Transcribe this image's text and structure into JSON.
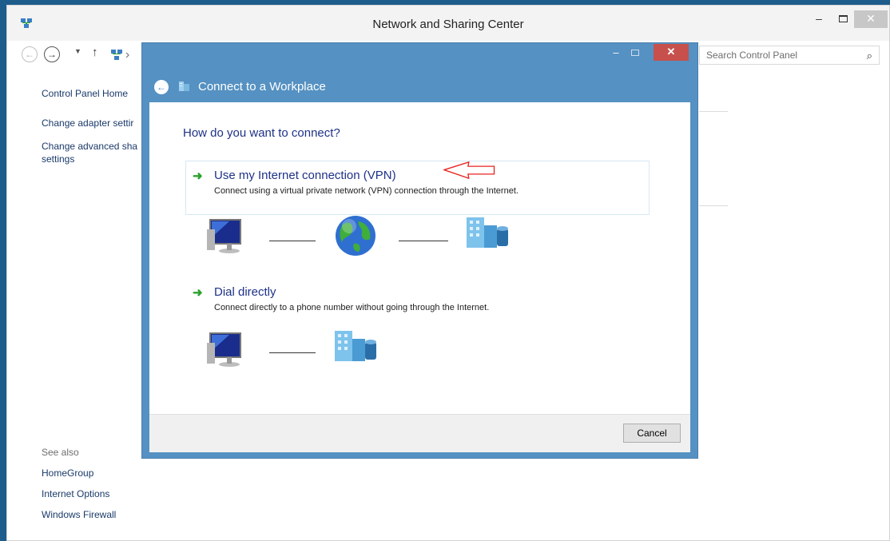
{
  "parent_window": {
    "title": "Network and Sharing Center",
    "controls": {
      "minimize": "–",
      "close": "✕"
    },
    "search": {
      "placeholder": "Search Control Panel"
    },
    "left_nav": {
      "home": "Control Panel Home",
      "change_adapter": "Change adapter settir",
      "change_advanced_line1": "Change advanced sha",
      "change_advanced_line2": "settings",
      "see_also": "See also",
      "see_also_links": [
        "HomeGroup",
        "Internet Options",
        "Windows Firewall"
      ]
    }
  },
  "dialog": {
    "title": "Connect to a Workplace",
    "question": "How do you want to connect?",
    "options": [
      {
        "title": "Use my Internet connection (VPN)",
        "description": "Connect using a virtual private network (VPN) connection through the Internet."
      },
      {
        "title": "Dial directly",
        "description": "Connect directly to a phone number without going through the Internet."
      }
    ],
    "cancel_label": "Cancel",
    "controls": {
      "minimize": "–",
      "close": "✕"
    }
  },
  "colors": {
    "desktop": "#1e5c8c",
    "dialog_frame": "#5591c2",
    "link_text": "#1a3a6a",
    "heading_text": "#1e3287",
    "green_arrow": "#2aa12d",
    "annotation_arrow": "#e8231f",
    "close_button": "#c7504c"
  },
  "icons": {
    "back": "back-arrow-icon",
    "forward": "forward-arrow-icon",
    "up": "up-arrow-icon",
    "search": "search-icon",
    "computer": "computer-icon",
    "internet": "globe-icon",
    "workplace": "building-icon"
  }
}
